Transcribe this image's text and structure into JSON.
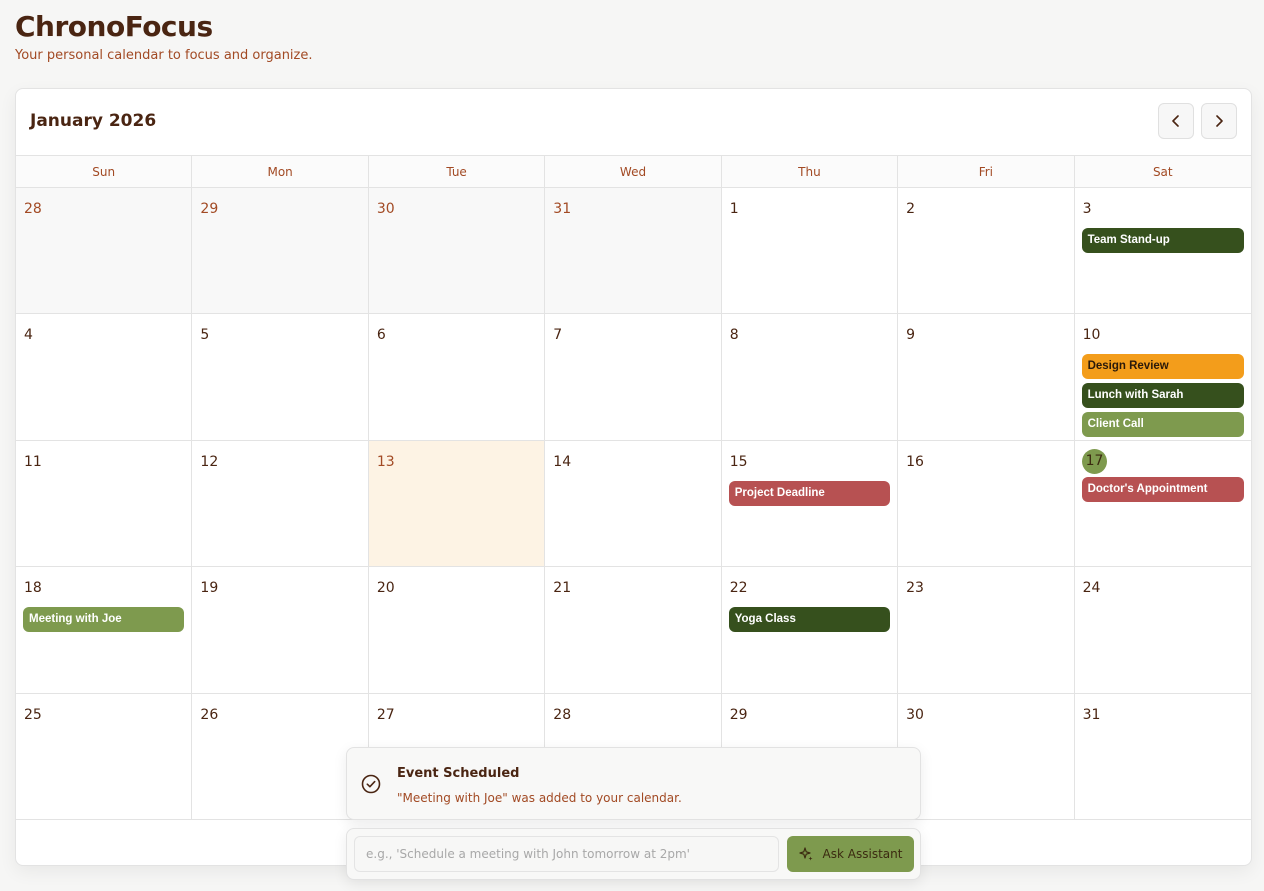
{
  "app": {
    "title": "ChronoFocus",
    "subtitle": "Your personal calendar to focus and organize."
  },
  "calendar": {
    "month_title": "January 2026",
    "prev_icon": "chevron-left-icon",
    "next_icon": "chevron-right-icon",
    "weekdays": [
      "Sun",
      "Mon",
      "Tue",
      "Wed",
      "Thu",
      "Fri",
      "Sat"
    ],
    "days": [
      {
        "num": "28",
        "other": true,
        "events": []
      },
      {
        "num": "29",
        "other": true,
        "events": []
      },
      {
        "num": "30",
        "other": true,
        "events": []
      },
      {
        "num": "31",
        "other": true,
        "events": []
      },
      {
        "num": "1",
        "events": []
      },
      {
        "num": "2",
        "events": []
      },
      {
        "num": "3",
        "events": [
          {
            "title": "Team Stand-up",
            "style": "dark"
          }
        ]
      },
      {
        "num": "4",
        "events": []
      },
      {
        "num": "5",
        "events": []
      },
      {
        "num": "6",
        "events": []
      },
      {
        "num": "7",
        "events": []
      },
      {
        "num": "8",
        "events": []
      },
      {
        "num": "9",
        "events": []
      },
      {
        "num": "10",
        "events": [
          {
            "title": "Design Review",
            "style": "orange"
          },
          {
            "title": "Lunch with Sarah",
            "style": "dark"
          },
          {
            "title": "Client Call",
            "style": "olive"
          }
        ]
      },
      {
        "num": "11",
        "events": []
      },
      {
        "num": "12",
        "events": []
      },
      {
        "num": "13",
        "today": true,
        "events": []
      },
      {
        "num": "14",
        "events": []
      },
      {
        "num": "15",
        "events": [
          {
            "title": "Project Deadline",
            "style": "red"
          }
        ]
      },
      {
        "num": "16",
        "events": []
      },
      {
        "num": "17",
        "selected": true,
        "events": [
          {
            "title": "Doctor's Appointment",
            "style": "red"
          }
        ]
      },
      {
        "num": "18",
        "events": [
          {
            "title": "Meeting with Joe",
            "style": "olive"
          }
        ]
      },
      {
        "num": "19",
        "events": []
      },
      {
        "num": "20",
        "events": []
      },
      {
        "num": "21",
        "events": []
      },
      {
        "num": "22",
        "events": [
          {
            "title": "Yoga Class",
            "style": "dark"
          }
        ]
      },
      {
        "num": "23",
        "events": []
      },
      {
        "num": "24",
        "events": []
      },
      {
        "num": "25",
        "events": []
      },
      {
        "num": "26",
        "events": []
      },
      {
        "num": "27",
        "events": []
      },
      {
        "num": "28",
        "events": []
      },
      {
        "num": "29",
        "events": []
      },
      {
        "num": "30",
        "events": []
      },
      {
        "num": "31",
        "events": []
      }
    ]
  },
  "toast": {
    "icon": "check-circle-icon",
    "title": "Event Scheduled",
    "message": "\"Meeting with Joe\" was added to your calendar."
  },
  "assistant": {
    "placeholder": "e.g., 'Schedule a meeting with John tomorrow at 2pm'",
    "value": "",
    "button_label": "Ask Assistant",
    "button_icon": "sparkles-icon"
  },
  "colors": {
    "accent_dark": "#36501d",
    "accent_olive": "#7e9a4e",
    "accent_orange": "#f39d1b",
    "accent_red": "#b75152",
    "text_primary": "#4a2512",
    "text_secondary": "#a24a24",
    "today_bg": "#fdf3e4"
  }
}
